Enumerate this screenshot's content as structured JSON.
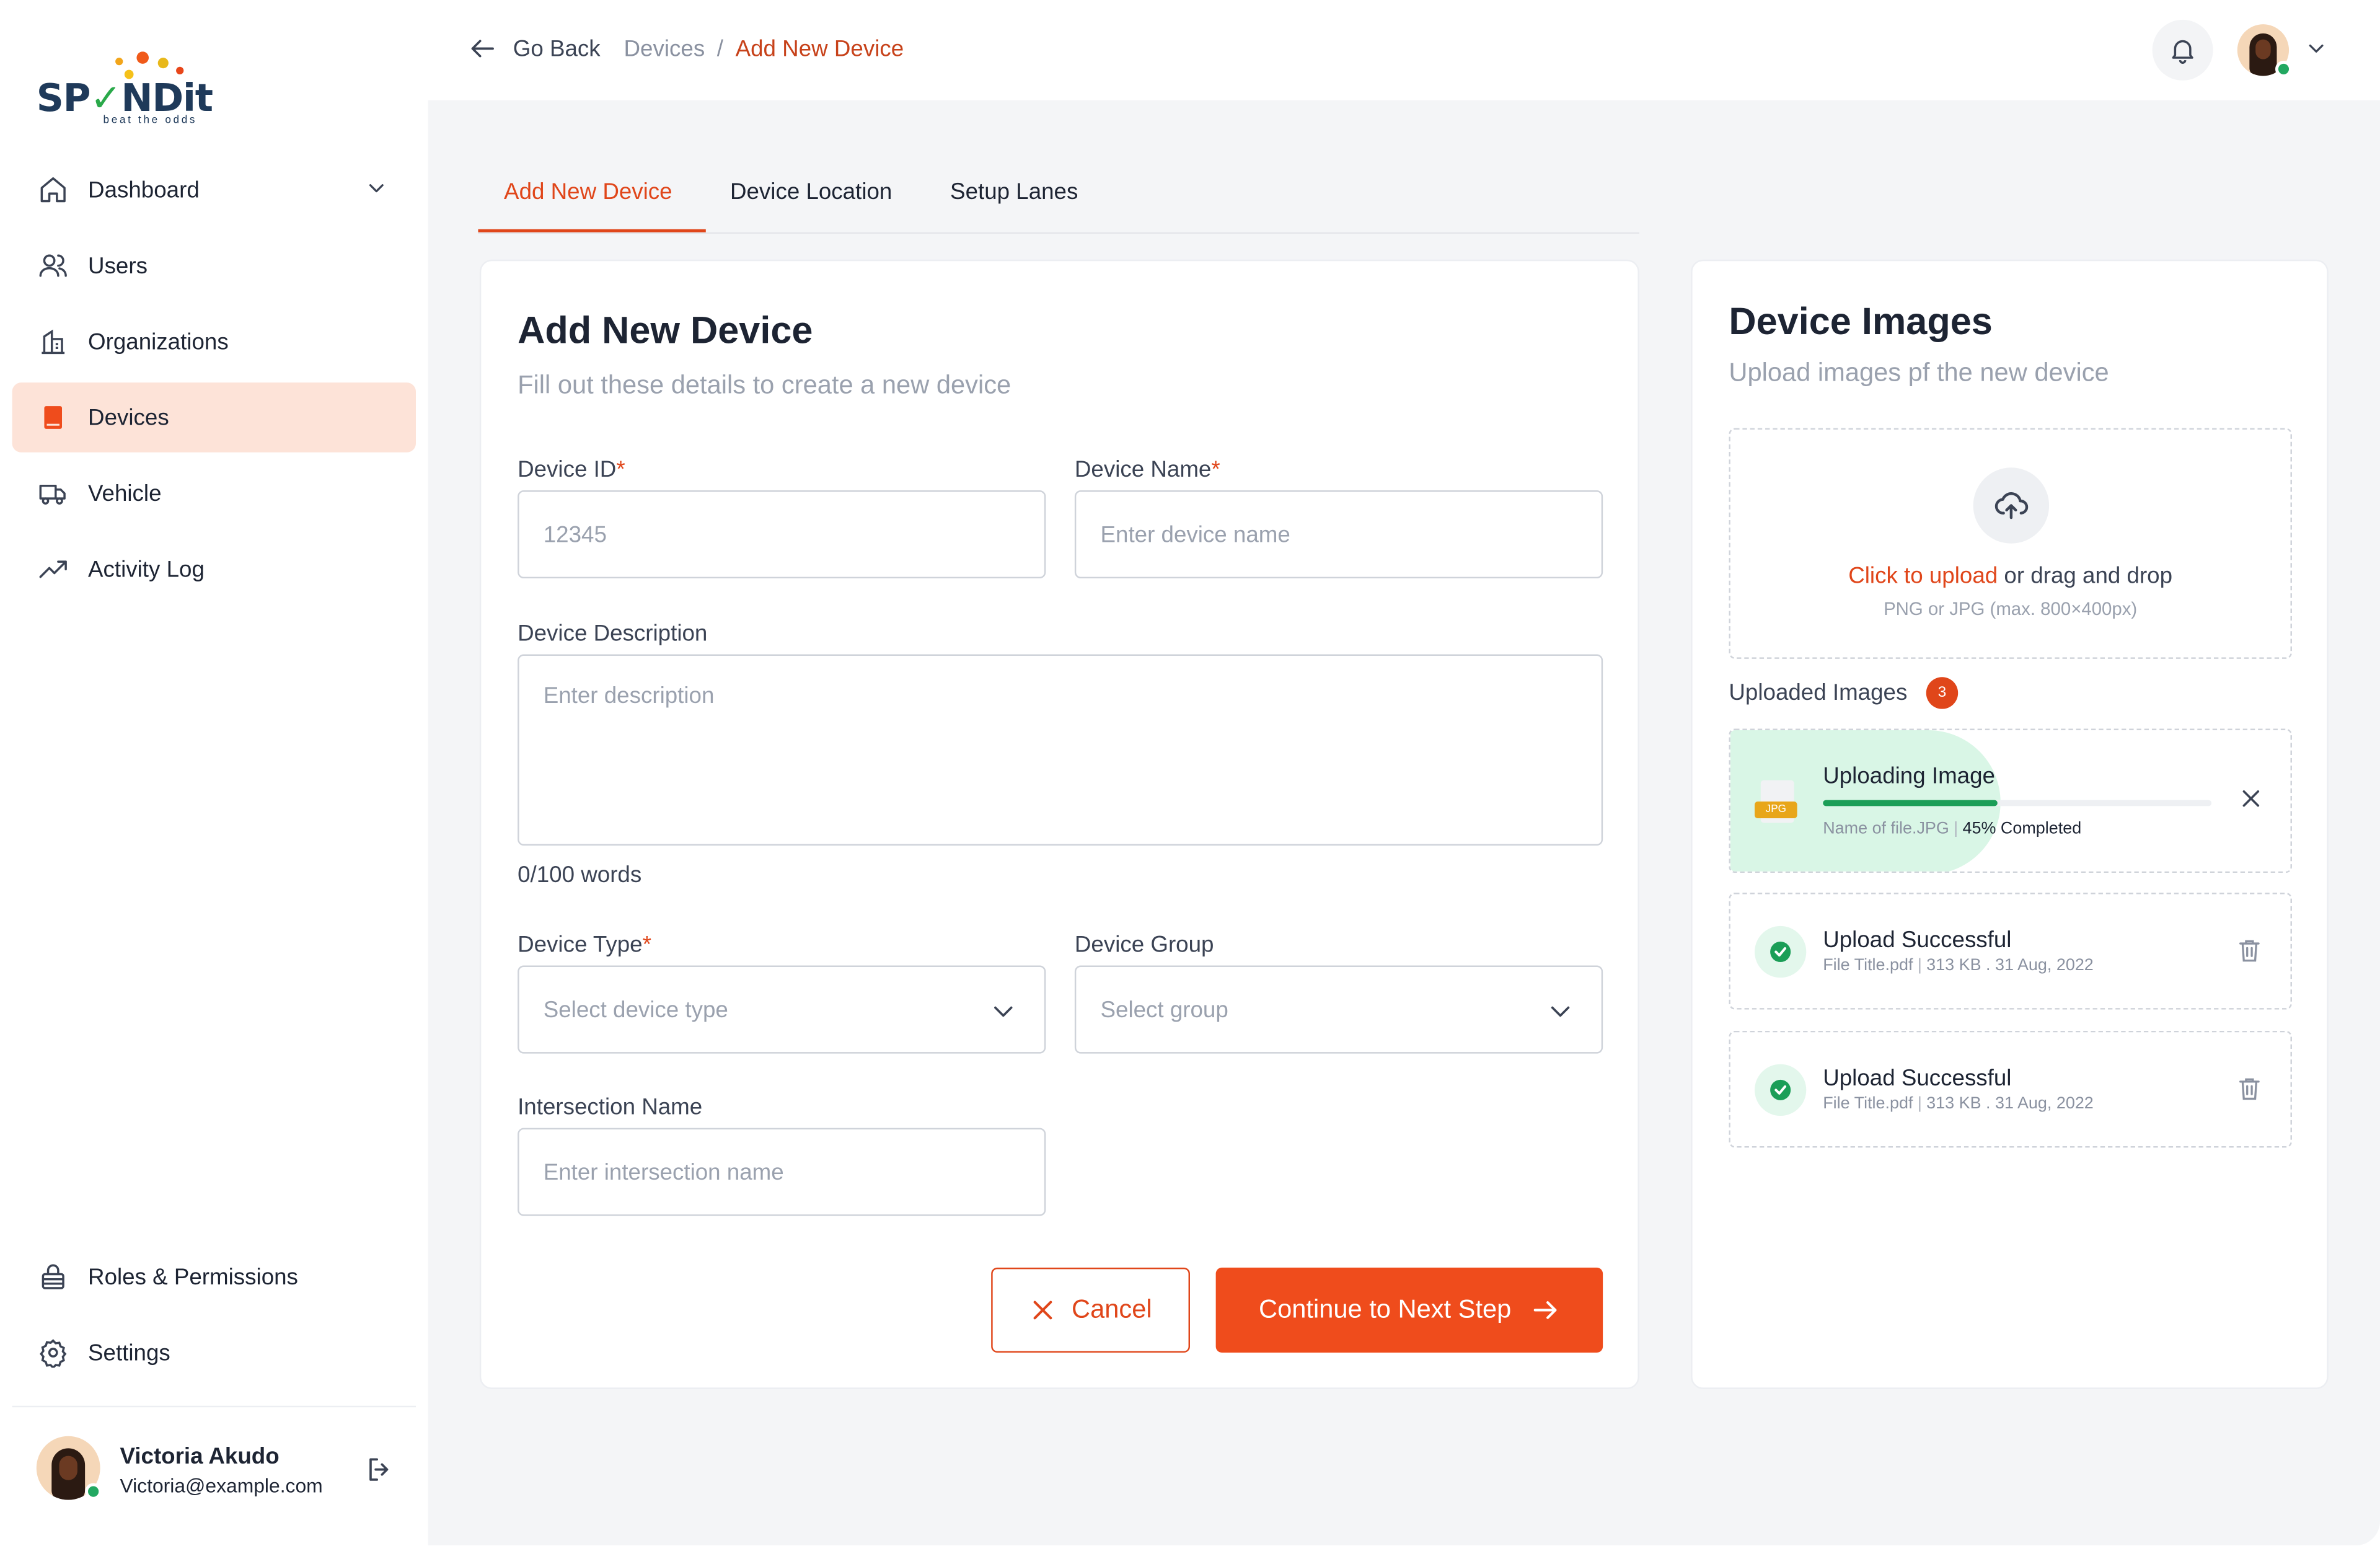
{
  "brand": {
    "logo_text": "SPONDit",
    "tagline": "beat the odds"
  },
  "sidebar": {
    "items": [
      {
        "label": "Dashboard",
        "icon": "home-icon",
        "active": false,
        "has_chevron": true
      },
      {
        "label": "Users",
        "icon": "users-icon",
        "active": false
      },
      {
        "label": "Organizations",
        "icon": "building-icon",
        "active": false
      },
      {
        "label": "Devices",
        "icon": "device-icon",
        "active": true
      },
      {
        "label": "Vehicle",
        "icon": "truck-icon",
        "active": false
      },
      {
        "label": "Activity Log",
        "icon": "trend-icon",
        "active": false
      }
    ],
    "bottom_items": [
      {
        "label": "Roles & Permissions",
        "icon": "lock-icon"
      },
      {
        "label": "Settings",
        "icon": "gear-icon"
      }
    ],
    "user": {
      "name": "Victoria Akudo",
      "email": "Victoria@example.com"
    }
  },
  "header": {
    "back_label": "Go Back",
    "breadcrumb": {
      "parent": "Devices",
      "separator": "/",
      "current": "Add New Device"
    }
  },
  "tabs": [
    {
      "label": "Add New Device",
      "active": true
    },
    {
      "label": "Device Location",
      "active": false
    },
    {
      "label": "Setup Lanes",
      "active": false
    }
  ],
  "form": {
    "title": "Add New Device",
    "subtitle": "Fill out these details to create a new device",
    "device_id": {
      "label": "Device ID",
      "required_mark": "*",
      "placeholder": "12345"
    },
    "device_name": {
      "label": "Device Name",
      "required_mark": "*",
      "placeholder": "Enter device name"
    },
    "description": {
      "label": "Device Description",
      "placeholder": "Enter description",
      "word_count": "0/100 words"
    },
    "device_type": {
      "label": "Device Type",
      "required_mark": "*",
      "placeholder": "Select device type"
    },
    "device_group": {
      "label": "Device Group",
      "placeholder": "Select group"
    },
    "intersection": {
      "label": "Intersection Name",
      "placeholder": "Enter intersection name"
    },
    "cancel_label": "Cancel",
    "next_label": "Continue to Next Step"
  },
  "images": {
    "title": "Device Images",
    "subtitle": "Upload images pf the new device",
    "dropzone": {
      "link": "Click to upload",
      "text": "or drag and drop",
      "hint": "PNG or JPG (max. 800×400px)"
    },
    "uploaded_label": "Uploaded Images",
    "uploaded_count": "3",
    "uploading": {
      "title": "Uploading Image",
      "file": "Name of file.JPG",
      "progress_text": "45% Completed",
      "progress": 0.45,
      "file_type": "JPG"
    },
    "done": [
      {
        "title": "Upload Successful",
        "file": "File Title.pdf",
        "meta": "313 KB . 31 Aug, 2022"
      },
      {
        "title": "Upload Successful",
        "file": "File Title.pdf",
        "meta": "313 KB . 31 Aug, 2022"
      }
    ]
  },
  "colors": {
    "accent": "#EF4C1C",
    "active_nav_bg": "#FDE3D8",
    "success": "#1B9E57"
  }
}
